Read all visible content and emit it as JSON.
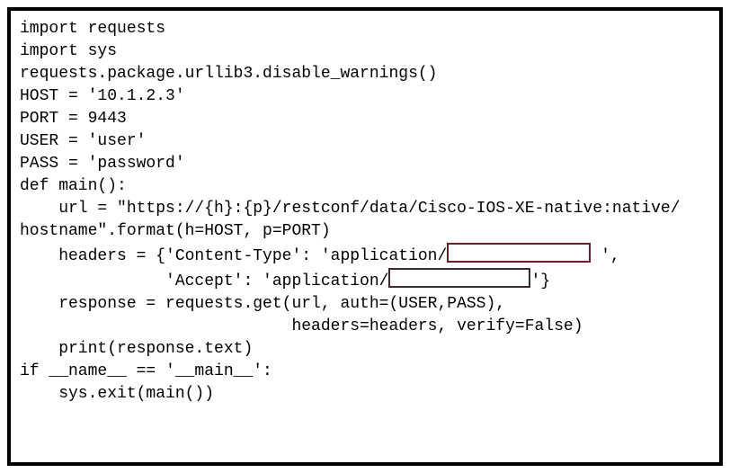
{
  "code": {
    "l1": "import requests",
    "l2": "import sys",
    "l3": "",
    "l4": "requests.package.urllib3.disable_warnings()",
    "l5": "",
    "l6": "HOST = '10.1.2.3'",
    "l7": "PORT = 9443",
    "l8": "USER = 'user'",
    "l9": "PASS = 'password'",
    "l10": "",
    "l11": "def main():",
    "l12": "    url = \"https://{h}:{p}/restconf/data/Cisco-IOS-XE-native:native/",
    "l13": "hostname\".format(h=HOST, p=PORT)",
    "l14": "",
    "headers_pre1": "    headers = {'Content-Type': 'application/",
    "headers_post1": " ',",
    "headers_pre2": "               'Accept': 'application/",
    "headers_post2": "'}",
    "l17": "    response = requests.get(url, auth=(USER,PASS),",
    "l18": "                            headers=headers, verify=False)",
    "l19": "    print(response.text)",
    "l20": "",
    "l21": "if __name__ == '__main__':",
    "l22": "    sys.exit(main())"
  },
  "blanks": {
    "blank1_answer": "",
    "blank2_answer": ""
  }
}
